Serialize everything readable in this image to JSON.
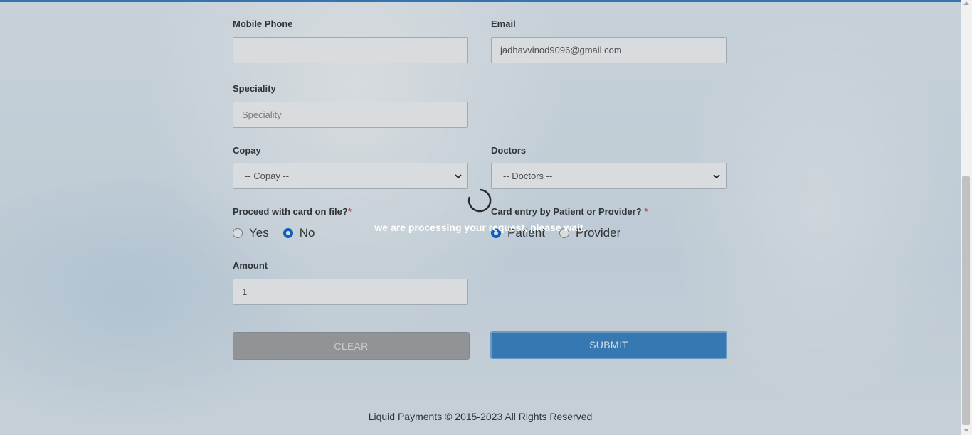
{
  "form": {
    "mobile_phone": {
      "label": "Mobile Phone",
      "value": ""
    },
    "email": {
      "label": "Email",
      "value": "jadhavvinod9096@gmail.com"
    },
    "speciality": {
      "label": "Speciality",
      "placeholder": "Speciality"
    },
    "copay": {
      "label": "Copay",
      "selected": "-- Copay --"
    },
    "doctors": {
      "label": "Doctors",
      "selected": "-- Doctors --"
    },
    "card_on_file": {
      "label": "Proceed with card on file?",
      "required_mark": "*",
      "options": [
        "Yes",
        "No"
      ],
      "selected": "No"
    },
    "card_entry": {
      "label": "Card entry by Patient or Provider?",
      "required_mark": "*",
      "options": [
        "Patient",
        "Provider"
      ],
      "selected": "Patient"
    },
    "amount": {
      "label": "Amount",
      "value": "1"
    },
    "clear_label": "CLEAR",
    "submit_label": "SUBMIT"
  },
  "loading": {
    "message": "we are processing your request, please wait."
  },
  "footer": {
    "text": "Liquid Payments © 2015-2023 All Rights Reserved"
  },
  "colors": {
    "accent": "#3a86c8",
    "radio_checked": "#0b66d6",
    "required": "#d9534f"
  }
}
